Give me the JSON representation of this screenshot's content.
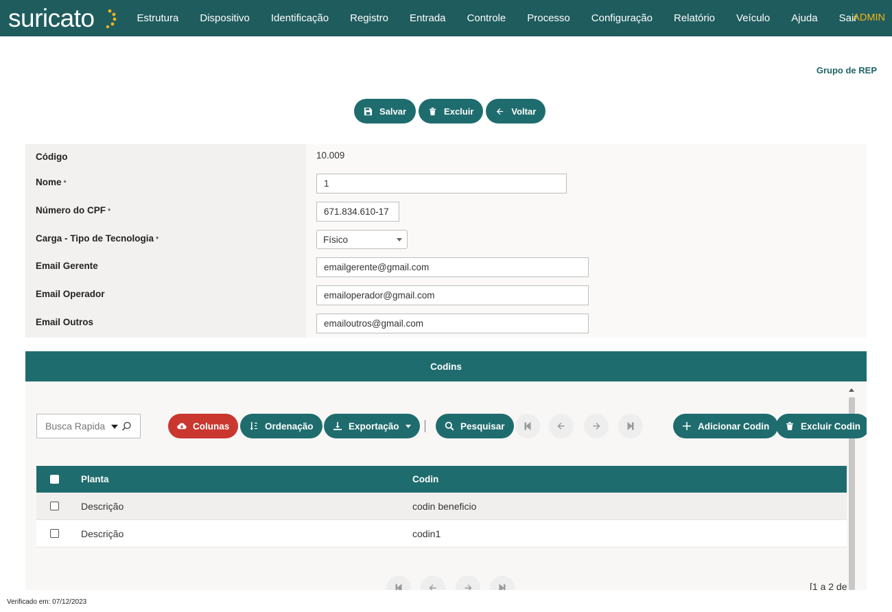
{
  "header": {
    "logo_text": "suricato",
    "nav": [
      "Estrutura",
      "Dispositivo",
      "Identificação",
      "Registro",
      "Entrada",
      "Controle",
      "Processo",
      "Configuração",
      "Relatório",
      "Veículo",
      "Ajuda",
      "Sair"
    ],
    "user": "ADMIN",
    "colors": {
      "bar": "#1f5c5e",
      "user": "#f2b418",
      "logo_dots": "#f2b418"
    }
  },
  "page": {
    "title": "Grupo de REP"
  },
  "actions": {
    "save": "Salvar",
    "delete": "Excluir",
    "back": "Voltar"
  },
  "form": {
    "codigo_label": "Código",
    "codigo_value": "10.009",
    "nome_label": "Nome",
    "nome_value": "1",
    "cpf_label": "Número do CPF",
    "cpf_value": "671.834.610-17",
    "carga_label": "Carga - Tipo de Tecnologia",
    "carga_value": "Físico",
    "email_gerente_label": "Email Gerente",
    "email_gerente_value": "emailgerente@gmail.com",
    "email_operador_label": "Email Operador",
    "email_operador_value": "emailoperador@gmail.com",
    "email_outros_label": "Email Outros",
    "email_outros_value": "emailoutros@gmail.com",
    "required_mark": "*"
  },
  "codins": {
    "section_title": "Codins",
    "search_placeholder": "Busca Rapida",
    "toolbar": {
      "columns": "Colunas",
      "sort": "Ordenação",
      "export": "Exportação",
      "search": "Pesquisar",
      "add": "Adicionar Codin",
      "delete": "Excluir Codin"
    },
    "columns": [
      "Planta",
      "Codin"
    ],
    "rows": [
      {
        "planta": "Descrição",
        "codin": "codin beneficio"
      },
      {
        "planta": "Descrição",
        "codin": "codin1"
      }
    ],
    "range_text": "[1 a 2 de"
  },
  "footer": {
    "verified": "Verificado em: 07/12/2023"
  },
  "colors": {
    "primary": "#1f6c6e",
    "danger": "#c9372f"
  }
}
